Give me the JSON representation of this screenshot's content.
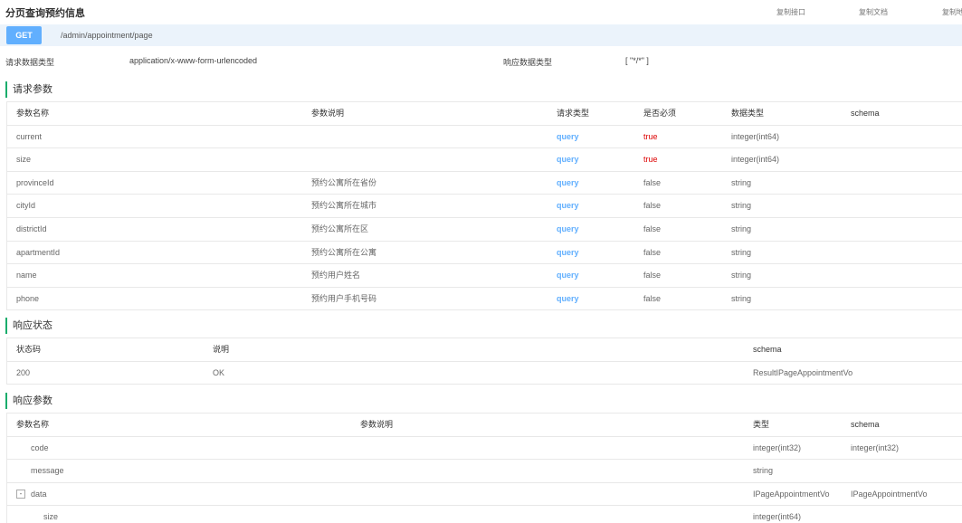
{
  "header": {
    "title": "分页查询预约信息",
    "actions": {
      "copy_api": "复制接口",
      "copy_doc": "复制文档",
      "copy_url": "复制地"
    }
  },
  "request": {
    "method": "GET",
    "path": "/admin/appointment/page",
    "request_type_label": "请求数据类型",
    "request_type_value": "application/x-www-form-urlencoded",
    "response_type_label": "响应数据类型",
    "response_type_value": "[ \"*/*\" ]"
  },
  "params": {
    "title": "请求参数",
    "headers": [
      "参数名称",
      "参数说明",
      "请求类型",
      "是否必须",
      "数据类型",
      "schema"
    ],
    "rows": [
      {
        "name": "current",
        "desc": "",
        "in": "query",
        "required": "true",
        "type": "integer(int64)",
        "schema": ""
      },
      {
        "name": "size",
        "desc": "",
        "in": "query",
        "required": "true",
        "type": "integer(int64)",
        "schema": ""
      },
      {
        "name": "provinceId",
        "desc": "预约公寓所在省份",
        "in": "query",
        "required": "false",
        "type": "string",
        "schema": ""
      },
      {
        "name": "cityId",
        "desc": "预约公寓所在城市",
        "in": "query",
        "required": "false",
        "type": "string",
        "schema": ""
      },
      {
        "name": "districtId",
        "desc": "预约公寓所在区",
        "in": "query",
        "required": "false",
        "type": "string",
        "schema": ""
      },
      {
        "name": "apartmentId",
        "desc": "预约公寓所在公寓",
        "in": "query",
        "required": "false",
        "type": "string",
        "schema": ""
      },
      {
        "name": "name",
        "desc": "预约用户姓名",
        "in": "query",
        "required": "false",
        "type": "string",
        "schema": ""
      },
      {
        "name": "phone",
        "desc": "预约用户手机号码",
        "in": "query",
        "required": "false",
        "type": "string",
        "schema": ""
      }
    ]
  },
  "status": {
    "title": "响应状态",
    "headers": [
      "状态码",
      "说明",
      "schema"
    ],
    "rows": [
      {
        "code": "200",
        "desc": "OK",
        "schema": "ResultIPageAppointmentVo"
      }
    ]
  },
  "response": {
    "title": "响应参数",
    "headers": [
      "参数名称",
      "参数说明",
      "类型",
      "schema"
    ],
    "rows": [
      {
        "name": "code",
        "desc": "",
        "type": "integer(int32)",
        "schema": "integer(int32)"
      },
      {
        "name": "message",
        "desc": "",
        "type": "string",
        "schema": ""
      },
      {
        "name": "data",
        "toggle": "-",
        "desc": "",
        "type": "IPageAppointmentVo",
        "schema": "IPageAppointmentVo"
      },
      {
        "name": "size",
        "desc": "",
        "type": "integer(int64)",
        "schema": ""
      }
    ]
  }
}
